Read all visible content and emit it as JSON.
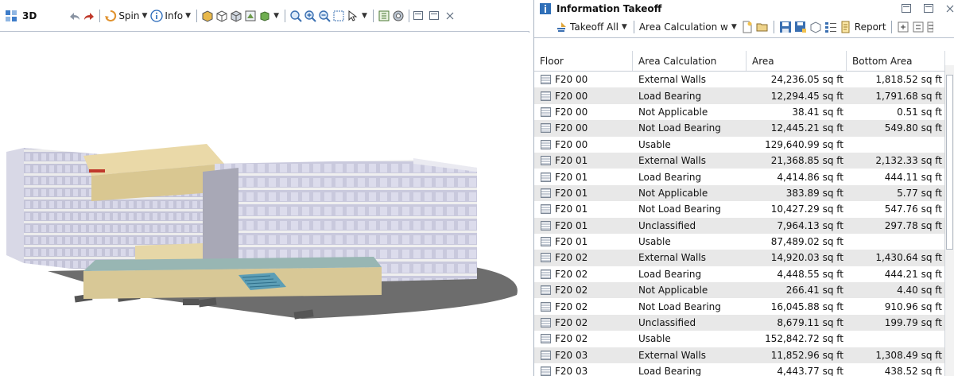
{
  "viewer": {
    "title": "3D",
    "spin_label": "Spin",
    "info_label": "Info"
  },
  "takeoff": {
    "title": "Information Takeoff",
    "takeoff_all_label": "Takeoff All",
    "area_calc_label": "Area Calculation w",
    "report_label": "Report"
  },
  "chart_data": {
    "type": "table",
    "columns": [
      "Floor",
      "Area Calculation",
      "Area",
      "Bottom Area"
    ],
    "rows": [
      [
        "F20 00",
        "External Walls",
        "24,236.05 sq ft",
        "1,818.52 sq ft"
      ],
      [
        "F20 00",
        "Load Bearing",
        "12,294.45 sq ft",
        "1,791.68 sq ft"
      ],
      [
        "F20 00",
        "Not Applicable",
        "38.41 sq ft",
        "0.51 sq ft"
      ],
      [
        "F20 00",
        "Not Load Bearing",
        "12,445.21 sq ft",
        "549.80 sq ft"
      ],
      [
        "F20 00",
        "Usable",
        "129,640.99 sq ft",
        ""
      ],
      [
        "F20 01",
        "External Walls",
        "21,368.85 sq ft",
        "2,132.33 sq ft"
      ],
      [
        "F20 01",
        "Load Bearing",
        "4,414.86 sq ft",
        "444.11 sq ft"
      ],
      [
        "F20 01",
        "Not Applicable",
        "383.89 sq ft",
        "5.77 sq ft"
      ],
      [
        "F20 01",
        "Not Load Bearing",
        "10,427.29 sq ft",
        "547.76 sq ft"
      ],
      [
        "F20 01",
        "Unclassified",
        "7,964.13 sq ft",
        "297.78 sq ft"
      ],
      [
        "F20 01",
        "Usable",
        "87,489.02 sq ft",
        ""
      ],
      [
        "F20 02",
        "External Walls",
        "14,920.03 sq ft",
        "1,430.64 sq ft"
      ],
      [
        "F20 02",
        "Load Bearing",
        "4,448.55 sq ft",
        "444.21 sq ft"
      ],
      [
        "F20 02",
        "Not Applicable",
        "266.41 sq ft",
        "4.40 sq ft"
      ],
      [
        "F20 02",
        "Not Load Bearing",
        "16,045.88 sq ft",
        "910.96 sq ft"
      ],
      [
        "F20 02",
        "Unclassified",
        "8,679.11 sq ft",
        "199.79 sq ft"
      ],
      [
        "F20 02",
        "Usable",
        "152,842.72 sq ft",
        ""
      ],
      [
        "F20 03",
        "External Walls",
        "11,852.96 sq ft",
        "1,308.49 sq ft"
      ],
      [
        "F20 03",
        "Load Bearing",
        "4,443.77 sq ft",
        "438.52 sq ft"
      ]
    ]
  }
}
